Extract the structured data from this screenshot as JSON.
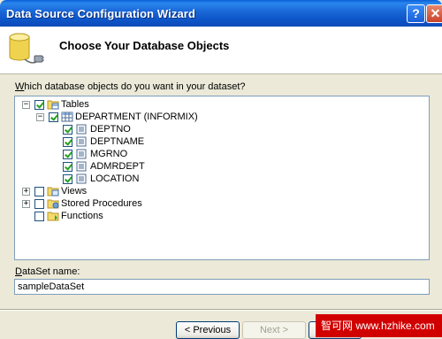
{
  "window": {
    "title": "Data Source Configuration Wizard",
    "help_glyph": "?",
    "close_glyph": "✕"
  },
  "header": {
    "title": "Choose Your Database Objects",
    "icon": "database-plug-icon"
  },
  "question": {
    "accel": "W",
    "rest": "hich database objects do you want in your dataset?"
  },
  "tree": {
    "tables": {
      "label": "Tables",
      "checked": true,
      "expanded": true
    },
    "department": {
      "label": "DEPARTMENT (INFORMIX)",
      "checked": true,
      "expanded": true
    },
    "columns": [
      {
        "label": "DEPTNO",
        "checked": true
      },
      {
        "label": "DEPTNAME",
        "checked": true
      },
      {
        "label": "MGRNO",
        "checked": true
      },
      {
        "label": "ADMRDEPT",
        "checked": true
      },
      {
        "label": "LOCATION",
        "checked": true
      }
    ],
    "views": {
      "label": "Views",
      "checked": false,
      "expanded": false
    },
    "procedures": {
      "label": "Stored Procedures",
      "checked": false,
      "expanded": false
    },
    "functions": {
      "label": "Functions",
      "checked": false
    }
  },
  "dataset": {
    "label_accel": "D",
    "label_rest": "ataSet name:",
    "value": "sampleDataSet"
  },
  "buttons": {
    "previous": "< Previous",
    "next": "Next >"
  },
  "watermark": "智可网 www.hzhike.com",
  "colors": {
    "titlebar": "#1865d6",
    "dialog_bg": "#ece9d8",
    "check_mark": "#21a121",
    "watermark_bg": "#d10000"
  }
}
